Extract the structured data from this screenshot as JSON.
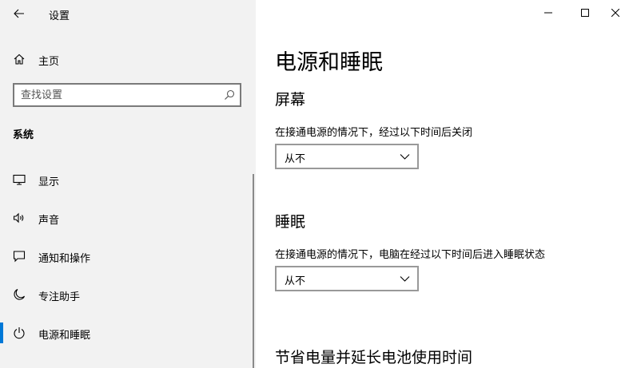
{
  "window": {
    "title": "设置",
    "minimize_icon": "minimize-icon",
    "maximize_icon": "maximize-icon",
    "close_icon": "close-icon"
  },
  "sidebar": {
    "home_label": "主页",
    "search_placeholder": "查找设置",
    "section_label": "系统",
    "items": [
      {
        "label": "显示",
        "icon": "monitor-icon"
      },
      {
        "label": "声音",
        "icon": "speaker-icon"
      },
      {
        "label": "通知和操作",
        "icon": "notification-icon"
      },
      {
        "label": "专注助手",
        "icon": "moon-icon"
      },
      {
        "label": "电源和睡眠",
        "icon": "power-icon",
        "selected": true
      }
    ]
  },
  "main": {
    "title": "电源和睡眠",
    "screen": {
      "heading": "屏幕",
      "description": "在接通电源的情况下，经过以下时间后关闭",
      "value": "从不"
    },
    "sleep": {
      "heading": "睡眠",
      "description": "在接通电源的情况下，电脑在经过以下时间后进入睡眠状态",
      "value": "从不"
    },
    "battery_heading": "节省电量并延长电池使用时间"
  },
  "colors": {
    "accent": "#0078d7",
    "sidebar_bg": "#f2f2f2"
  }
}
